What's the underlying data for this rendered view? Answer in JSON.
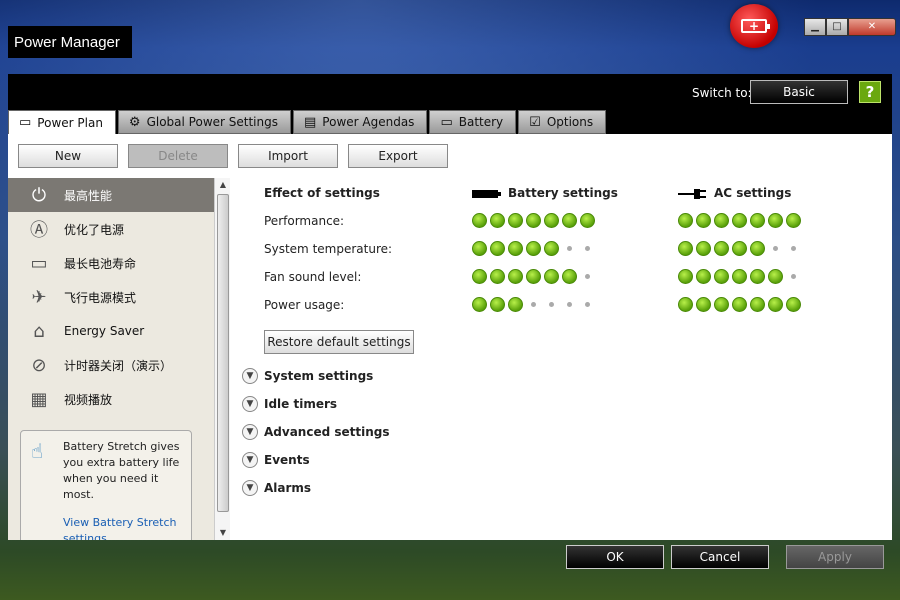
{
  "window": {
    "title": "Power Manager",
    "controls": [
      "minimize",
      "maximize",
      "close"
    ]
  },
  "header": {
    "switch_label": "Switch to:",
    "switch_button": "Basic",
    "help_symbol": "?"
  },
  "tabs": [
    {
      "label": "Power Plan",
      "active": true
    },
    {
      "label": "Global Power Settings",
      "active": false
    },
    {
      "label": "Power Agendas",
      "active": false
    },
    {
      "label": "Battery",
      "active": false
    },
    {
      "label": "Options",
      "active": false
    }
  ],
  "toolbar": {
    "new": "New",
    "delete": "Delete",
    "import": "Import",
    "export": "Export"
  },
  "sidebar": {
    "items": [
      {
        "label": "最高性能",
        "icon": "power-icon",
        "selected": true
      },
      {
        "label": "优化了电源",
        "icon": "auto-icon",
        "selected": false
      },
      {
        "label": "最长电池寿命",
        "icon": "battery-clock-icon",
        "selected": false
      },
      {
        "label": "飞行电源模式",
        "icon": "airplane-icon",
        "selected": false
      },
      {
        "label": "Energy Saver",
        "icon": "house-icon",
        "selected": false
      },
      {
        "label": "计时器关闭（演示）",
        "icon": "projector-icon",
        "selected": false
      },
      {
        "label": "视频播放",
        "icon": "film-icon",
        "selected": false
      }
    ],
    "stretch": {
      "text": "Battery Stretch gives you extra battery life when you need it most.",
      "link": "View Battery Stretch settings"
    }
  },
  "effects": {
    "heading": "Effect of settings",
    "battery_heading": "Battery settings",
    "ac_heading": "AC settings",
    "rows": [
      {
        "label": "Performance:",
        "battery": 7,
        "ac": 7
      },
      {
        "label": "System temperature:",
        "battery": 5,
        "ac": 5
      },
      {
        "label": "Fan sound level:",
        "battery": 6,
        "ac": 6
      },
      {
        "label": "Power usage:",
        "battery": 3,
        "ac": 7
      }
    ],
    "scale_max": 7,
    "restore_label": "Restore default settings"
  },
  "sections": [
    "System settings",
    "Idle timers",
    "Advanced settings",
    "Events",
    "Alarms"
  ],
  "footer": {
    "ok": "OK",
    "cancel": "Cancel",
    "apply": "Apply"
  },
  "colors": {
    "active_dot": "#6cc416",
    "logo": "#d40000"
  }
}
